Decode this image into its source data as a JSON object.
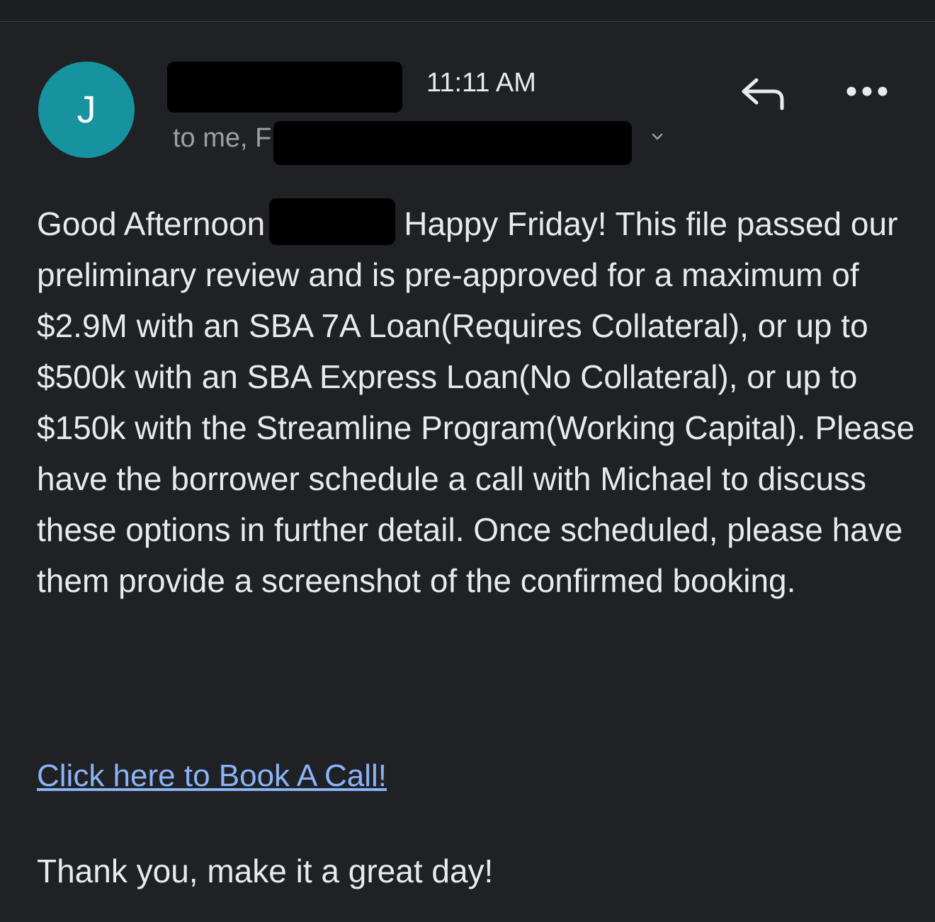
{
  "email": {
    "sender_initial": "J",
    "time": "11:11 AM",
    "to_prefix": "to me, F",
    "greeting": "Good Afternoon",
    "body_first_line_rest": "Happy Friday! This file passed",
    "body_rest": "our preliminary review and is pre-approved for a maximum of $2.9M with an SBA 7A Loan(Requires Collateral), or up to $500k with an SBA Express Loan(No Collateral), or up to $150k with the Streamline Program(Working Capital). Please have the borrower schedule a call with Michael to discuss these options in further detail. Once scheduled, please have them provide a screenshot of the confirmed booking.",
    "link_text": "Click here to Book A Call!",
    "signoff": "Thank you, make it a great day!"
  },
  "icons": {
    "avatar": "avatar",
    "reply": "reply-icon",
    "more": "more-options-icon",
    "expand": "chevron-down-icon"
  },
  "colors": {
    "background": "#202124",
    "avatar": "#16939e",
    "link": "#8ab4f8",
    "muted_text": "#9aa0a6"
  }
}
